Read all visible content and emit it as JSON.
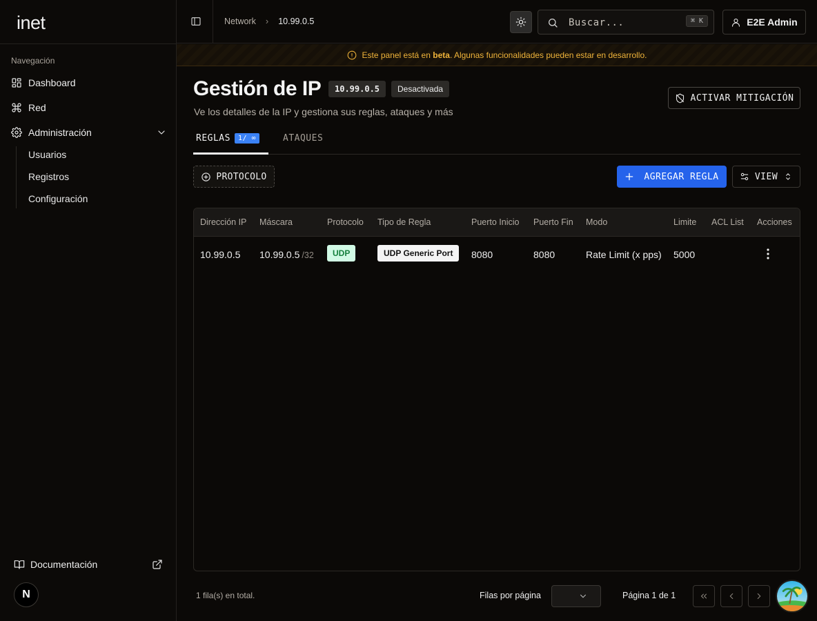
{
  "app": {
    "logo": "inet"
  },
  "sidebar": {
    "section_title": "Navegación",
    "items": [
      {
        "label": "Dashboard",
        "icon": "dashboard-icon"
      },
      {
        "label": "Red",
        "icon": "command-icon"
      },
      {
        "label": "Administración",
        "icon": "gear-icon"
      }
    ],
    "sub_items": [
      {
        "label": "Usuarios"
      },
      {
        "label": "Registros"
      },
      {
        "label": "Configuración"
      }
    ],
    "docs_label": "Documentación",
    "avatar_letter": "N"
  },
  "header": {
    "breadcrumb": [
      "Network",
      "10.99.0.5"
    ],
    "search_placeholder": "Buscar...",
    "search_shortcut": "⌘ K",
    "user_label": "E2E Admin"
  },
  "banner": {
    "prefix": "Este panel está en ",
    "emphasis": "beta",
    "suffix": ". Algunas funcionalidades pueden estar en desarrollo.",
    "color": "#f0b43a"
  },
  "page": {
    "title": "Gestión de IP",
    "ip": "10.99.0.5",
    "status": "Desactivada",
    "subtitle": "Ve los detalles de la IP y gestiona sus reglas, ataques y más",
    "mitigation_button": "ACTIVAR MITIGACIÓN"
  },
  "tabs": [
    {
      "label": "REGLAS",
      "count": "1/ ∞",
      "active": true
    },
    {
      "label": "ATAQUES",
      "active": false
    }
  ],
  "toolbar": {
    "protocol_filter": "PROTOCOLO",
    "add_rule": "AGREGAR REGLA",
    "view": "VIEW",
    "accent": "#2563eb"
  },
  "table": {
    "columns": [
      "Dirección IP",
      "Máscara",
      "Protocolo",
      "Tipo de Regla",
      "Puerto Inicio",
      "Puerto Fin",
      "Modo",
      "Limite",
      "ACL List",
      "Acciones"
    ],
    "rows": [
      {
        "ip": "10.99.0.5",
        "mask": "10.99.0.5",
        "mask_suffix": "/32",
        "protocol": "UDP",
        "rule_type": "UDP Generic Port",
        "port_start": "8080",
        "port_end": "8080",
        "mode": "Rate Limit (x pps)",
        "limit": "5000",
        "acl_list": ""
      }
    ]
  },
  "footer": {
    "total": "1 fila(s) en total.",
    "rows_per_page_label": "Filas por página",
    "rows_per_page_value": "",
    "page_info": "Página 1 de 1"
  }
}
